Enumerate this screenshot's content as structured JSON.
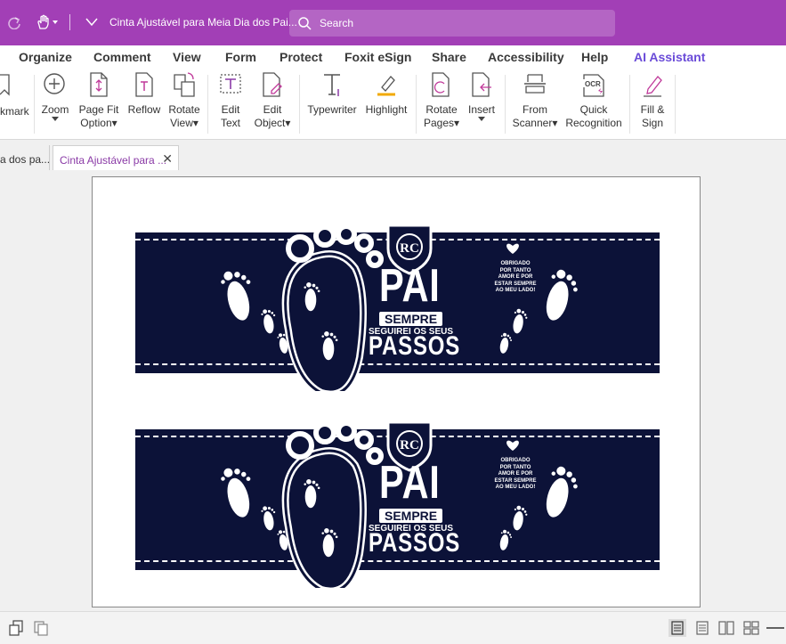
{
  "titlebar": {
    "doc_title": "Cinta Ajustável para Meia Dia dos Pai...",
    "search_placeholder": "Search"
  },
  "menu": [
    "Organize",
    "Comment",
    "View",
    "Form",
    "Protect",
    "Foxit eSign",
    "Share",
    "Accessibility",
    "Help",
    "AI Assistant"
  ],
  "ribbon": {
    "bookmark": "kmark",
    "zoom": "Zoom",
    "page_fit_1": "Page Fit",
    "page_fit_2": "Option",
    "reflow": "Reflow",
    "rotate_view_1": "Rotate",
    "rotate_view_2": "View",
    "edit_text_1": "Edit",
    "edit_text_2": "Text",
    "edit_object_1": "Edit",
    "edit_object_2": "Object",
    "typewriter": "Typewriter",
    "highlight": "Highlight",
    "rotate_pages_1": "Rotate",
    "rotate_pages_2": "Pages",
    "insert": "Insert",
    "from_scanner_1": "From",
    "from_scanner_2": "Scanner",
    "quick_recog_1": "Quick",
    "quick_recog_2": "Recognition",
    "fill_sign_1": "Fill &",
    "fill_sign_2": "Sign",
    "ocr_badge": "OCR"
  },
  "tabs": {
    "inactive": "a dos pa...",
    "active": "Cinta Ajustável para ...",
    "close": "✕"
  },
  "document": {
    "emblem_initials": "RC",
    "title": "PAI",
    "sempre": "SEMPRE",
    "seguirei": "SEGUIREI OS SEUS",
    "passos": "PASSOS",
    "message": [
      "OBRIGADO",
      "POR TANTO",
      "AMOR E POR",
      "ESTAR SEMPRE",
      "AO MEU LADO!"
    ]
  },
  "colors": {
    "titlebar": "#a23fb6",
    "accent": "#8a3aa6",
    "ai_assistant": "#6a4bd8",
    "band": "#0c1238"
  }
}
